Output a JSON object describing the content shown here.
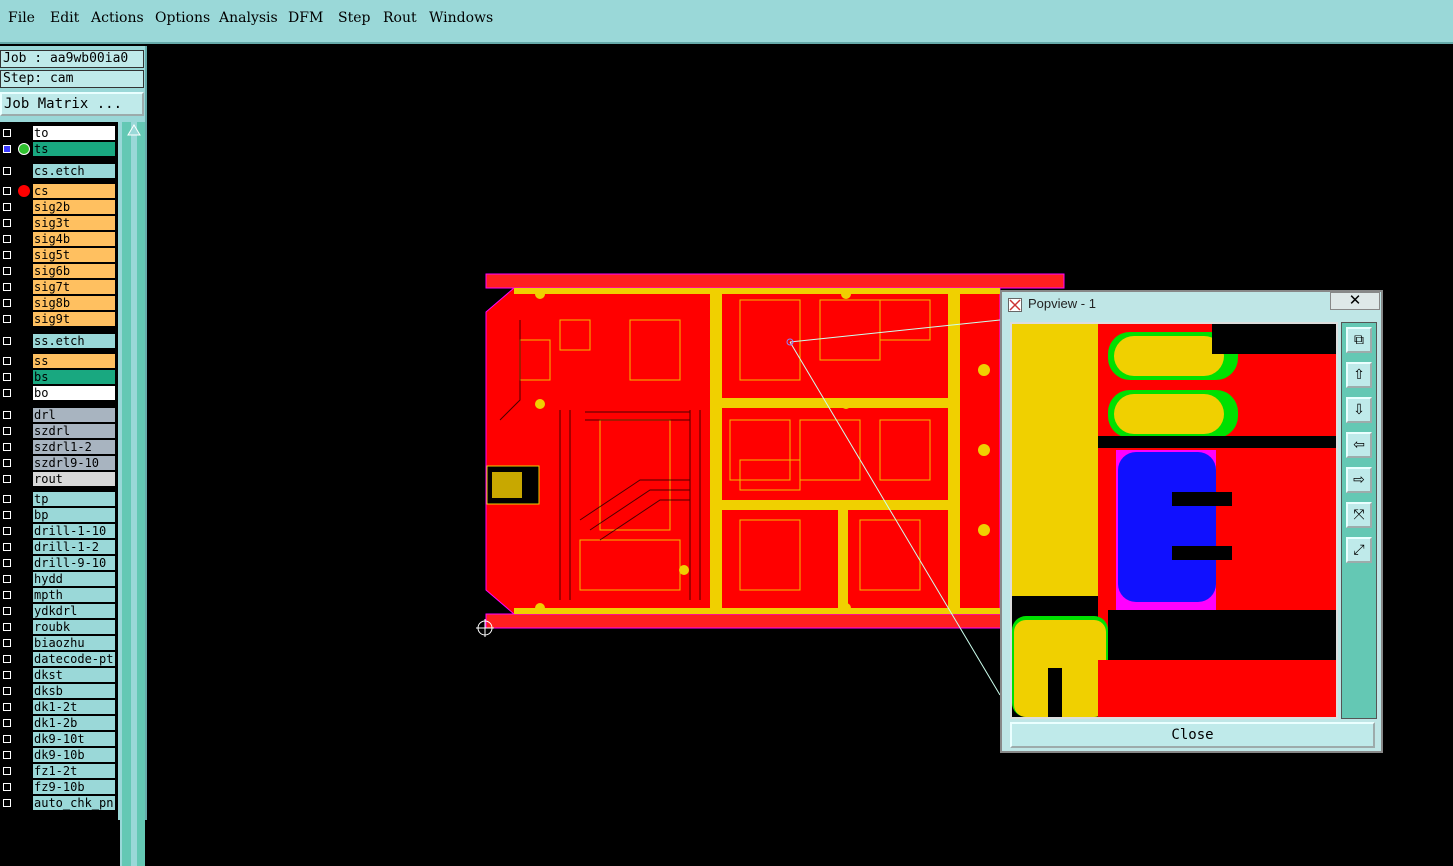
{
  "menu": [
    "File",
    "Edit",
    "Actions",
    "Options",
    "Analysis",
    "DFM",
    "Step",
    "Rout",
    "Windows"
  ],
  "job": "Job : aa9wb00ia0",
  "step": "Step: cam",
  "job_matrix": "Job Matrix ...",
  "layers": [
    {
      "name": "to",
      "color": "#ffffff"
    },
    {
      "name": "ts",
      "color": "#19a880",
      "selected": true
    },
    {
      "name": "cs.etch",
      "color": "#9ad8d8"
    },
    {
      "name": "cs",
      "color": "#ffc060",
      "active": true
    },
    {
      "name": "sig2b",
      "color": "#ffc060"
    },
    {
      "name": "sig3t",
      "color": "#ffc060"
    },
    {
      "name": "sig4b",
      "color": "#ffc060"
    },
    {
      "name": "sig5t",
      "color": "#ffc060"
    },
    {
      "name": "sig6b",
      "color": "#ffc060"
    },
    {
      "name": "sig7t",
      "color": "#ffc060"
    },
    {
      "name": "sig8b",
      "color": "#ffc060"
    },
    {
      "name": "sig9t",
      "color": "#ffc060"
    },
    {
      "name": "ss.etch",
      "color": "#9ad8d8"
    },
    {
      "name": "ss",
      "color": "#ffc060"
    },
    {
      "name": "bs",
      "color": "#19a880"
    },
    {
      "name": "bo",
      "color": "#ffffff"
    },
    {
      "name": "drl",
      "color": "#a8b4c0"
    },
    {
      "name": "szdrl",
      "color": "#a8b4c0"
    },
    {
      "name": "szdrl1-2",
      "color": "#a8b4c0"
    },
    {
      "name": "szdrl9-10",
      "color": "#a8b4c0"
    },
    {
      "name": "rout",
      "color": "#d8d8d8"
    },
    {
      "name": "tp",
      "color": "#9ad8d8"
    },
    {
      "name": "bp",
      "color": "#9ad8d8"
    },
    {
      "name": "drill-1-10",
      "color": "#9ad8d8"
    },
    {
      "name": "drill-1-2",
      "color": "#9ad8d8"
    },
    {
      "name": "drill-9-10",
      "color": "#9ad8d8"
    },
    {
      "name": "hydd",
      "color": "#9ad8d8"
    },
    {
      "name": "mpth",
      "color": "#9ad8d8"
    },
    {
      "name": "ydkdrl",
      "color": "#9ad8d8"
    },
    {
      "name": "roubk",
      "color": "#9ad8d8"
    },
    {
      "name": "biaozhu",
      "color": "#9ad8d8"
    },
    {
      "name": "datecode-pt",
      "color": "#9ad8d8"
    },
    {
      "name": "dkst",
      "color": "#9ad8d8"
    },
    {
      "name": "dksb",
      "color": "#9ad8d8"
    },
    {
      "name": "dk1-2t",
      "color": "#9ad8d8"
    },
    {
      "name": "dk1-2b",
      "color": "#9ad8d8"
    },
    {
      "name": "dk9-10t",
      "color": "#9ad8d8"
    },
    {
      "name": "dk9-10b",
      "color": "#9ad8d8"
    },
    {
      "name": "fz1-2t",
      "color": "#9ad8d8"
    },
    {
      "name": "fz9-10b",
      "color": "#9ad8d8"
    },
    {
      "name": "auto_chk_pn",
      "color": "#9ad8d8"
    }
  ],
  "popview": {
    "title": "Popview - 1",
    "close_x": "✕",
    "close_label": "Close"
  },
  "colors": {
    "board_red": "#ff0000",
    "pad_yellow": "#f0d000",
    "mask_green": "#00e000",
    "blue_layer": "#1010ff",
    "magenta": "#ff00ff"
  }
}
